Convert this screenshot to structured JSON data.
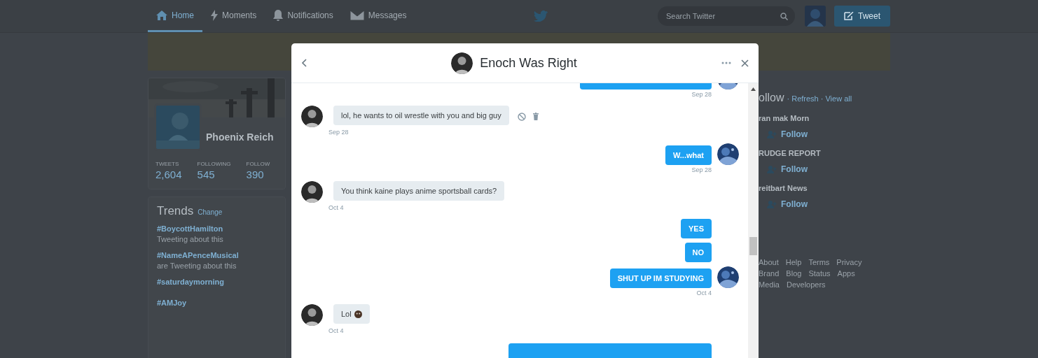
{
  "nav": {
    "tabs": [
      {
        "label": "Home",
        "selected": true
      },
      {
        "label": "Moments",
        "selected": false
      },
      {
        "label": "Notifications",
        "selected": false
      },
      {
        "label": "Messages",
        "selected": false
      }
    ],
    "search": {
      "placeholder": "Search Twitter"
    },
    "tweet_button": "Tweet"
  },
  "profile": {
    "name": "Phoenix Reich",
    "stats": [
      {
        "label": "TWEETS",
        "value": "2,604"
      },
      {
        "label": "FOLLOWING",
        "value": "545"
      },
      {
        "label": "FOLLOW",
        "value": "390"
      }
    ]
  },
  "trends": {
    "title": "Trends",
    "change": "Change",
    "items": [
      {
        "tag": "#BoycottHamilton",
        "context": "Tweeting about this"
      },
      {
        "tag": "#NameAPenceMusical",
        "context": "are Tweeting about this"
      },
      {
        "tag": "#saturdaymorning"
      },
      {
        "tag": "#AMJoy"
      }
    ]
  },
  "who_to_follow": {
    "title": "ollow",
    "links": "· Refresh · View all",
    "accounts": [
      {
        "name": "ran mak Morn",
        "follow": "Follow"
      },
      {
        "name": "RUDGE REPORT",
        "follow": "Follow"
      },
      {
        "name": "reitbart News",
        "follow": "Follow"
      }
    ]
  },
  "footer": [
    "About",
    "Help",
    "Terms",
    "Privacy",
    "Brand",
    "Blog",
    "Status",
    "Apps",
    "Media",
    "Developers"
  ],
  "dialog": {
    "title": "Enoch Was Right",
    "messages": [
      {
        "kind": "sent",
        "time": "Sep 28",
        "avatar": true
      },
      {
        "kind": "received",
        "text": "lol, he wants to oil wrestle with you and big guy",
        "time": "Sep 28",
        "avatar": true,
        "actions": true
      },
      {
        "kind": "sent",
        "text": "W...what",
        "time": "Sep 28",
        "avatar": true
      },
      {
        "kind": "received",
        "text": "You think kaine plays anime sportsball cards?",
        "time": "Oct 4",
        "avatar": true
      },
      {
        "kind": "sent",
        "text": "YES",
        "avatar": false
      },
      {
        "kind": "sent",
        "text": "NO",
        "avatar": false
      },
      {
        "kind": "sent",
        "text": "SHUT UP IM STUDYING",
        "time": "Oct 4",
        "avatar": true
      },
      {
        "kind": "received",
        "text": "Lol",
        "emoji": true,
        "time": "Oct 4",
        "avatar": true
      },
      {
        "kind": "sent",
        "avatar": false
      }
    ]
  }
}
